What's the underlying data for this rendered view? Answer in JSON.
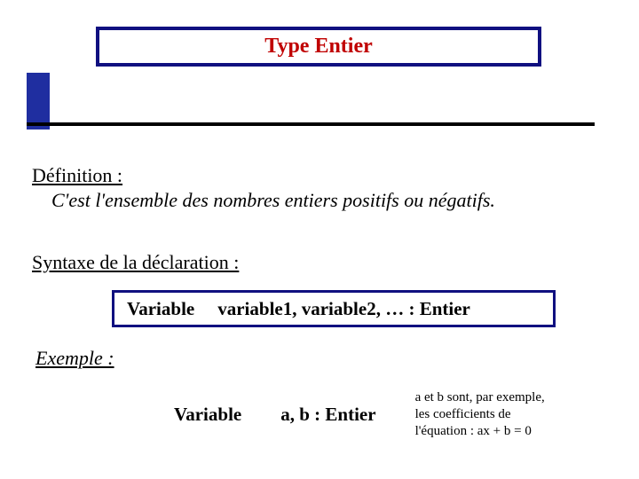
{
  "title": "Type Entier",
  "definition": {
    "label": "Définition :",
    "text": "C'est l'ensemble des nombres entiers positifs ou négatifs."
  },
  "syntax": {
    "label": "Syntaxe de la déclaration :",
    "keyword": "Variable",
    "declaration": "variable1, variable2, …  : Entier"
  },
  "example": {
    "label": "Exemple :",
    "keyword": "Variable",
    "declaration": "a, b  : Entier",
    "note_line1": "a et b sont, par exemple,",
    "note_line2": "les coefficients de",
    "note_line3": "l'équation :  ax + b = 0"
  }
}
